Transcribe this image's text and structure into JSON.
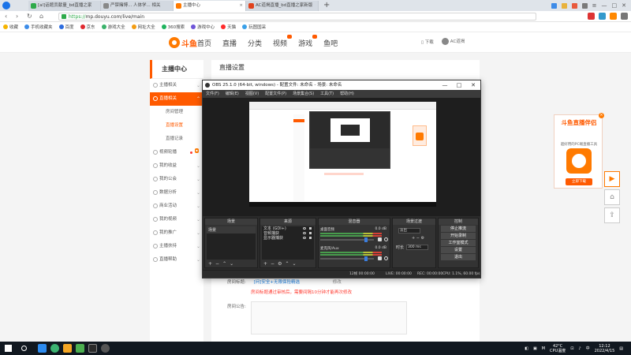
{
  "browser": {
    "tabs": [
      {
        "label": "[al]话题贡献量_bd直播之家",
        "color": "#2eaa4a"
      },
      {
        "label": "严禁赌博... 人体学... 相关",
        "color": "#888888"
      },
      {
        "label": "主播中心",
        "color": "#ff7a00"
      },
      {
        "label": "AC道揭直播_bd直播之家新版",
        "color": "#e0421c"
      }
    ],
    "url_scheme": "https://",
    "url_rest": "mp.douyu.com/live/main",
    "bookmarks": [
      "收藏",
      "手机收藏夹",
      "百度",
      "京东",
      "游戏大全",
      "网址大全",
      "360搜索",
      "游戏中心",
      "天猫",
      "玩图国采"
    ]
  },
  "site": {
    "logo_text": "斗鱼",
    "nav": [
      "首页",
      "直播",
      "分类",
      "视频",
      "游戏",
      "鱼吧"
    ],
    "header_right": {
      "download": "下载",
      "user": "AC道揭"
    },
    "sidebar": {
      "title": "主播中心",
      "items": [
        {
          "label": "主播相关",
          "type": "top"
        },
        {
          "label": "直播相关",
          "type": "top-active"
        },
        {
          "label": "房间管理",
          "type": "sub"
        },
        {
          "label": "直播设置",
          "type": "sub-selected"
        },
        {
          "label": "直播记录",
          "type": "sub"
        },
        {
          "label": "视频轮播",
          "type": "top"
        },
        {
          "label": "我的收益",
          "type": "top"
        },
        {
          "label": "我的公会",
          "type": "top"
        },
        {
          "label": "数据分析",
          "type": "top"
        },
        {
          "label": "商业活动",
          "type": "top"
        },
        {
          "label": "我的视频",
          "type": "top"
        },
        {
          "label": "我的推广",
          "type": "top"
        },
        {
          "label": "主播扶持",
          "type": "top"
        },
        {
          "label": "直播帮助",
          "type": "top"
        }
      ]
    },
    "content": {
      "title": "直播设置",
      "room_title_label": "房间标题:",
      "room_title_value": "[问]安全+无限保险精选",
      "room_title_edit": "修改",
      "room_title_warn": "房间标题通过审核后，需要间隔10分钟才能再次修改",
      "notice_label": "房间公告:"
    },
    "ad": {
      "title": "斗鱼直播伴侣",
      "subtitle": "超好用的PC端直播工具",
      "button": "立即下载",
      "close": "×"
    }
  },
  "obs": {
    "title": "OBS 25.1.0 (64-bit, windows) - 配置文件: 未命名 - 场景: 未命名",
    "menu": [
      "文件(F)",
      "编辑(E)",
      "视图(V)",
      "配置文件(P)",
      "场景集合(S)",
      "工具(T)",
      "帮助(H)"
    ],
    "docks": {
      "scenes": {
        "title": "场景",
        "items": [
          "场景"
        ]
      },
      "sources": {
        "title": "来源",
        "items": [
          "文本 (GDI+)",
          "音频捕获",
          "显示器捕获"
        ]
      },
      "mixer": {
        "title": "混音器",
        "channels": [
          {
            "name": "桌面音频",
            "db": "0.0 dB"
          },
          {
            "name": "麦克风/Aux",
            "db": "0.0 dB"
          }
        ]
      },
      "transitions": {
        "title": "场景过渡",
        "type": "淡出",
        "duration_label": "时长",
        "duration_value": "300 ms"
      },
      "controls": {
        "title": "控制",
        "buttons": [
          "停止推流",
          "开始录制",
          "工作室模式",
          "设置",
          "退出"
        ]
      }
    },
    "status": {
      "live": "LIVE: 00:00:00",
      "rec": "REC: 00:00:00",
      "cpu": "CPU: 1.1%, 60.00 fps",
      "dropped": "12帧 00:00:00"
    }
  },
  "taskbar": {
    "temp": "42°C",
    "temp_label": "CPU温度",
    "time": "12:12",
    "date": "2022/4/15"
  }
}
